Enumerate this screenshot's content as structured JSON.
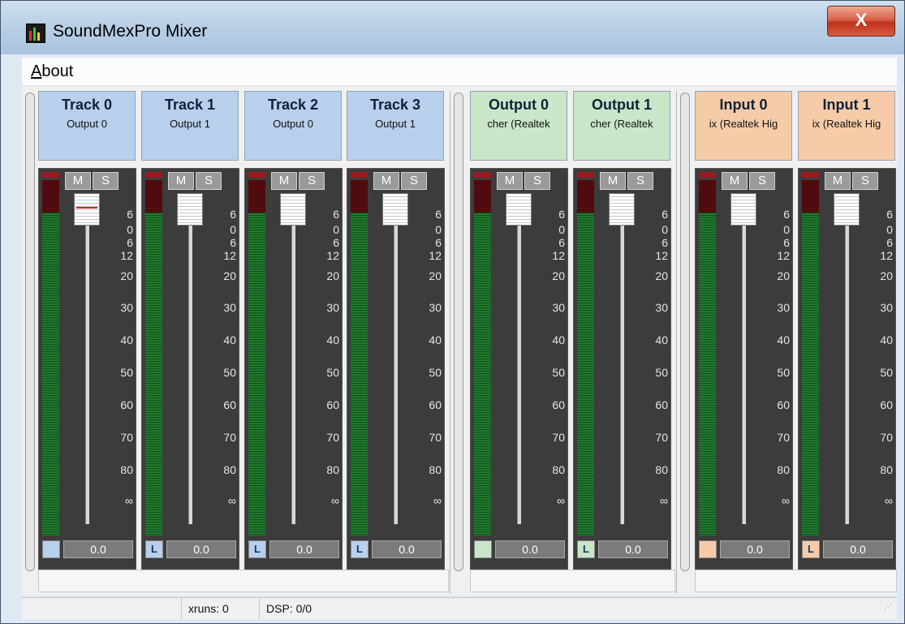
{
  "window": {
    "title": "SoundMexPro Mixer",
    "close_label": "X"
  },
  "menu": {
    "about": "About"
  },
  "strips": [
    {
      "name": "Track 0",
      "sub": "Output 0",
      "color": "blue",
      "link": "",
      "mute": "M",
      "solo": "S",
      "value": "0.0"
    },
    {
      "name": "Track 1",
      "sub": "Output 1",
      "color": "blue",
      "link": "L",
      "mute": "M",
      "solo": "S",
      "value": "0.0"
    },
    {
      "name": "Track 2",
      "sub": "Output 0",
      "color": "blue",
      "link": "L",
      "mute": "M",
      "solo": "S",
      "value": "0.0"
    },
    {
      "name": "Track 3",
      "sub": "Output 1",
      "color": "blue",
      "link": "L",
      "mute": "M",
      "solo": "S",
      "value": "0.0"
    },
    {
      "name": "Output 0",
      "sub": "cher (Realtek",
      "color": "green",
      "link": "",
      "mute": "M",
      "solo": "S",
      "value": "0.0"
    },
    {
      "name": "Output 1",
      "sub": "cher (Realtek",
      "color": "green",
      "link": "L",
      "mute": "M",
      "solo": "S",
      "value": "0.0"
    },
    {
      "name": "Input 0",
      "sub": "ix (Realtek Hig",
      "color": "orange",
      "link": "",
      "mute": "M",
      "solo": "S",
      "value": "0.0"
    },
    {
      "name": "Input 1",
      "sub": "ix (Realtek Hig",
      "color": "orange",
      "link": "L",
      "mute": "M",
      "solo": "S",
      "value": "0.0"
    }
  ],
  "scale_ticks": [
    "6",
    "0",
    "6",
    "12",
    "20",
    "30",
    "40",
    "50",
    "60",
    "70",
    "80",
    "∞"
  ],
  "status": {
    "xruns": "xruns: 0",
    "dsp": "DSP: 0/0"
  },
  "colors": {
    "track": "#b9d0ec",
    "output": "#c9e6c9",
    "input": "#f6cca8",
    "meter_green": "#1f7a2d",
    "meter_red": "#5a0d10"
  }
}
